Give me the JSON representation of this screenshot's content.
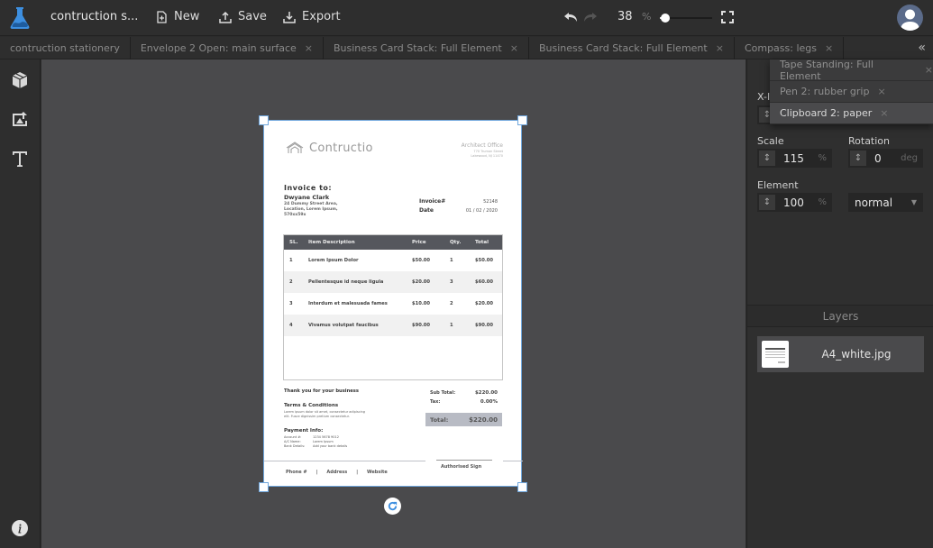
{
  "app": {
    "title": "contruction s...",
    "new_label": "New",
    "save_label": "Save",
    "export_label": "Export",
    "zoom_value": "38",
    "zoom_unit": "%",
    "zoom_slider_percent": 10
  },
  "tabs": [
    {
      "label": "contruction stationery",
      "closable": false
    },
    {
      "label": "Envelope 2 Open: main surface",
      "closable": true
    },
    {
      "label": "Business Card Stack: Full Element",
      "closable": true
    },
    {
      "label": "Business Card Stack: Full Element",
      "closable": true
    },
    {
      "label": "Compass: legs",
      "closable": true
    }
  ],
  "tab_close_glyph": "×",
  "collapse_glyph": "«",
  "overflow_tabs": [
    {
      "label": "Tape Standing: Full Element",
      "active": false
    },
    {
      "label": "Pen 2: rubber grip",
      "active": false
    },
    {
      "label": "Clipboard 2: paper",
      "active": true
    }
  ],
  "left_tools": [
    "box-icon",
    "image-upload-icon",
    "text-icon"
  ],
  "properties": {
    "x_label": "X-I",
    "scale_label": "Scale",
    "scale_value": "115",
    "scale_unit": "%",
    "rotation_label": "Rotation",
    "rotation_value": "0",
    "rotation_unit": "deg",
    "element_label": "Element",
    "element_value": "100",
    "element_unit": "%",
    "blend_mode": "normal",
    "spin_glyph": "↕"
  },
  "layers": {
    "title": "Layers",
    "items": [
      {
        "name": "A4_white.jpg"
      }
    ]
  },
  "document": {
    "brand": "Contructio",
    "office_title": "Architect Office",
    "office_line1": "770 Truman Street",
    "office_line2": "Lakewood, NJ 11470",
    "invoice_to_label": "Invoice to:",
    "client_name": "Dwyane Clark",
    "client_address1": "24 Dummy Street Area,",
    "client_address2": "Location, Lorem Ipsum,",
    "client_address3": "570xx59x",
    "invoice_no_label": "Invoice#",
    "invoice_no": "52148",
    "date_label": "Date",
    "date": "01 / 02 / 2020",
    "table_headers": [
      "SL.",
      "Item Description",
      "Price",
      "Qty.",
      "Total"
    ],
    "items": [
      {
        "sl": "1",
        "desc": "Lorem Ipsum Dolor",
        "price": "$50.00",
        "qty": "1",
        "total": "$50.00"
      },
      {
        "sl": "2",
        "desc": "Pellentesque id neque ligula",
        "price": "$20.00",
        "qty": "3",
        "total": "$60.00"
      },
      {
        "sl": "3",
        "desc": "Interdum et malesuada fames",
        "price": "$10.00",
        "qty": "2",
        "total": "$20.00"
      },
      {
        "sl": "4",
        "desc": "Vivamus volutpat faucibus",
        "price": "$90.00",
        "qty": "1",
        "total": "$90.00"
      }
    ],
    "thanks": "Thank you for your business",
    "terms_title": "Terms & Conditions",
    "terms_line1": "Lorem ipsum dolor sit amet, consectetur adipiscing",
    "terms_line2": "elit. Fusce dignissim pretium consectetur.",
    "payment_title": "Payment Info:",
    "account_label": "Account #:",
    "account_value": "1234 5678 9012",
    "ac_name_label": "A/C Name:",
    "ac_name_value": "Lorem Ipsum",
    "bank_label": "Bank Details:",
    "bank_value": "Add your bank details",
    "subtotal_label": "Sub Total:",
    "subtotal": "$220.00",
    "tax_label": "Tax:",
    "tax": "0.00%",
    "total_label": "Total:",
    "total": "$220.00",
    "sign_label": "Authorised Sign",
    "footer_phone": "Phone #",
    "footer_sep": "|",
    "footer_address": "Address",
    "footer_website": "Website"
  }
}
